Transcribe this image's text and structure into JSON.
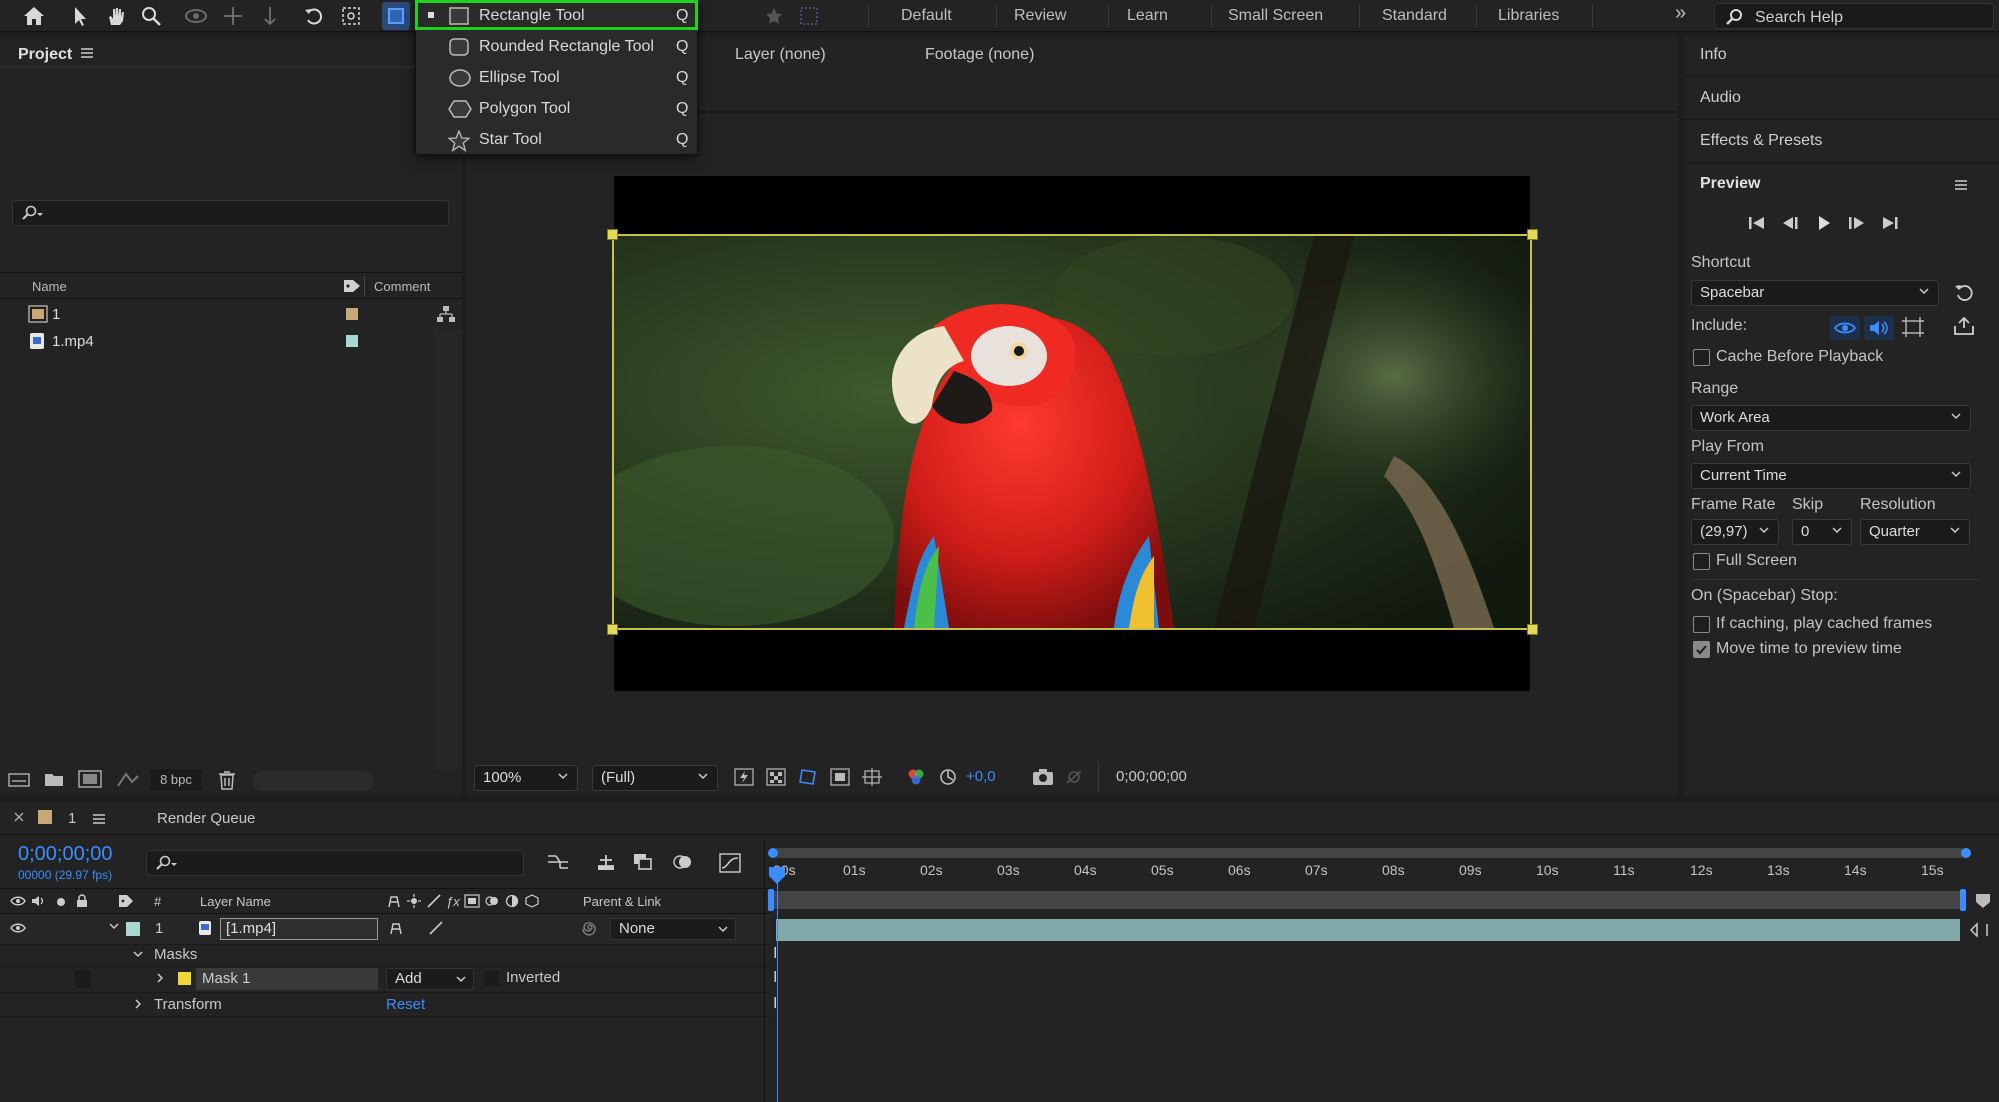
{
  "toolbar": {
    "workspaces": [
      "Default",
      "Review",
      "Learn",
      "Small Screen",
      "Standard",
      "Libraries"
    ],
    "search_help": "Search Help",
    "overflow": "»"
  },
  "shape_menu": {
    "items": [
      {
        "label": "Rectangle Tool",
        "key": "Q"
      },
      {
        "label": "Rounded Rectangle Tool",
        "key": "Q"
      },
      {
        "label": "Ellipse Tool",
        "key": "Q"
      },
      {
        "label": "Polygon Tool",
        "key": "Q"
      },
      {
        "label": "Star Tool",
        "key": "Q"
      }
    ],
    "selected": "Rectangle Tool"
  },
  "project": {
    "title": "Project",
    "columns": {
      "name": "Name",
      "comment": "Comment"
    },
    "items": [
      {
        "name": "1",
        "color": "#c8a878"
      },
      {
        "name": "1.mp4",
        "color": "#a8d8d0"
      }
    ],
    "bpc": "8 bpc"
  },
  "viewer": {
    "layer_label": "Layer (none)",
    "footage_label": "Footage (none)",
    "zoom": "100%",
    "resolution": "(Full)",
    "exposure": "+0,0",
    "timecode": "0;00;00;00"
  },
  "right_panel": {
    "tabs": [
      "Info",
      "Audio",
      "Effects & Presets"
    ],
    "preview": {
      "title": "Preview",
      "shortcut_label": "Shortcut",
      "shortcut_value": "Spacebar",
      "include_label": "Include:",
      "cache_before_playback": "Cache Before Playback",
      "range_label": "Range",
      "range_value": "Work Area",
      "play_from_label": "Play From",
      "play_from_value": "Current Time",
      "frame_rate_label": "Frame Rate",
      "skip_label": "Skip",
      "resolution_label": "Resolution",
      "frame_rate_value": "(29,97)",
      "skip_value": "0",
      "resolution_value": "Quarter",
      "full_screen": "Full Screen",
      "on_stop_label": "On (Spacebar) Stop:",
      "if_caching": "If caching, play cached frames",
      "move_time": "Move time to preview time"
    }
  },
  "timeline": {
    "comp_tab": "1",
    "render_queue": "Render Queue",
    "current_time": "0;00;00;00",
    "frame_info": "00000 (29.97 fps)",
    "col_num": "#",
    "col_layer_name": "Layer Name",
    "col_parent": "Parent & Link",
    "layer": {
      "num": "1",
      "name": "[1.mp4]",
      "parent": "None"
    },
    "masks_label": "Masks",
    "mask_name": "Mask 1",
    "mask_mode": "Add",
    "inverted": "Inverted",
    "transform": "Transform",
    "reset": "Reset",
    "ticks": [
      "00s",
      "01s",
      "02s",
      "03s",
      "04s",
      "05s",
      "06s",
      "07s",
      "08s",
      "09s",
      "10s",
      "11s",
      "12s",
      "13s",
      "14s",
      "15s"
    ]
  }
}
